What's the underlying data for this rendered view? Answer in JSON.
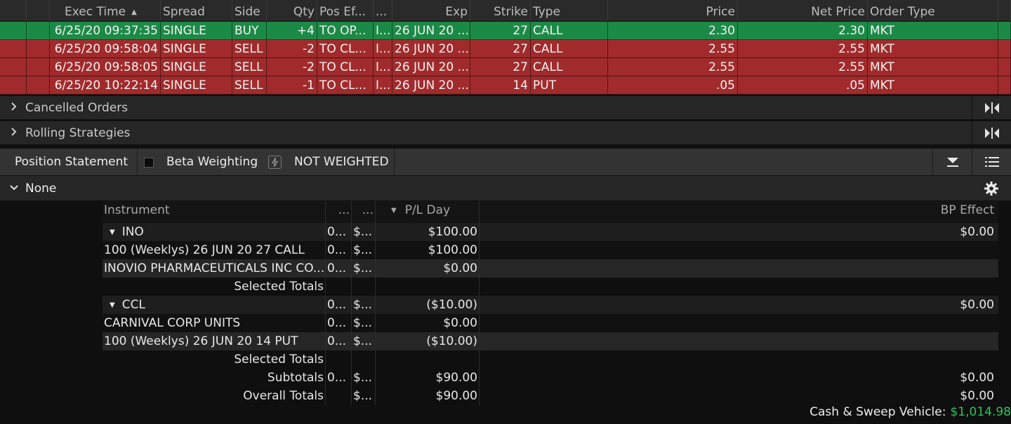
{
  "orders": {
    "columns": {
      "exec_time": "Exec Time",
      "spread": "Spread",
      "side": "Side",
      "qty": "Qty",
      "pos_effect": "Pos Ef...",
      "dots": "...",
      "exp": "Exp",
      "strike": "Strike",
      "type": "Type",
      "price": "Price",
      "net_price": "Net Price",
      "order_type": "Order Type"
    },
    "rows": [
      {
        "exec_time": "6/25/20 09:37:35",
        "spread": "SINGLE",
        "side": "BUY",
        "qty": "+4",
        "pos_effect": "TO OP...",
        "dots": "I...",
        "exp": "26 JUN 20 ...",
        "strike": "27",
        "type": "CALL",
        "price": "2.30",
        "net_price": "2.30",
        "order_type": "MKT"
      },
      {
        "exec_time": "6/25/20 09:58:04",
        "spread": "SINGLE",
        "side": "SELL",
        "qty": "-2",
        "pos_effect": "TO CL...",
        "dots": "I...",
        "exp": "26 JUN 20 ...",
        "strike": "27",
        "type": "CALL",
        "price": "2.55",
        "net_price": "2.55",
        "order_type": "MKT"
      },
      {
        "exec_time": "6/25/20 09:58:05",
        "spread": "SINGLE",
        "side": "SELL",
        "qty": "-2",
        "pos_effect": "TO CL...",
        "dots": "I...",
        "exp": "26 JUN 20 ...",
        "strike": "27",
        "type": "CALL",
        "price": "2.55",
        "net_price": "2.55",
        "order_type": "MKT"
      },
      {
        "exec_time": "6/25/20 10:22:14",
        "spread": "SINGLE",
        "side": "SELL",
        "qty": "-1",
        "pos_effect": "TO CL...",
        "dots": "I...",
        "exp": "26 JUN 20 ...",
        "strike": "14",
        "type": "PUT",
        "price": ".05",
        "net_price": ".05",
        "order_type": "MKT"
      }
    ]
  },
  "sections": {
    "cancelled": "Cancelled Orders",
    "rolling": "Rolling Strategies"
  },
  "position_statement": {
    "title": "Position Statement",
    "beta_label": "Beta Weighting",
    "not_weighted": "NOT WEIGHTED",
    "group_label": "None"
  },
  "positions": {
    "columns": {
      "instrument": "Instrument",
      "d1": "...",
      "d2": "...",
      "pl_day": "P/L Day",
      "bp_effect": "BP Effect"
    },
    "rows": [
      {
        "kind": "grp",
        "instrument": "INO",
        "d1": "0...",
        "d2": "$...",
        "pl_day": "$100.00",
        "bp_effect": "$0.00"
      },
      {
        "kind": "plain",
        "instrument": "100 (Weeklys) 26 JUN 20 27 CALL",
        "d1": "0...",
        "d2": "$...",
        "pl_day": "$100.00",
        "bp_effect": ""
      },
      {
        "kind": "alt",
        "instrument": "INOVIO PHARMACEUTICALS INC CO...",
        "d1": "0...",
        "d2": "$...",
        "pl_day": "$0.00",
        "bp_effect": ""
      },
      {
        "kind": "tot",
        "instrument": "Selected Totals",
        "d1": "",
        "d2": "",
        "pl_day": "",
        "bp_effect": ""
      },
      {
        "kind": "grp",
        "instrument": "CCL",
        "d1": "0...",
        "d2": "$...",
        "pl_day": "($10.00)",
        "bp_effect": "$0.00"
      },
      {
        "kind": "plain",
        "instrument": "CARNIVAL CORP UNITS",
        "d1": "0...",
        "d2": "$...",
        "pl_day": "$0.00",
        "bp_effect": ""
      },
      {
        "kind": "alt",
        "instrument": "100 (Weeklys) 26 JUN 20 14 PUT",
        "d1": "0...",
        "d2": "$...",
        "pl_day": "($10.00)",
        "bp_effect": ""
      },
      {
        "kind": "tot",
        "instrument": "Selected Totals",
        "d1": "",
        "d2": "",
        "pl_day": "",
        "bp_effect": ""
      },
      {
        "kind": "tot",
        "instrument": "Subtotals",
        "d1": "0...",
        "d2": "$...",
        "pl_day": "$90.00",
        "bp_effect": "$0.00"
      },
      {
        "kind": "tot",
        "instrument": "Overall Totals",
        "d1": "",
        "d2": "$...",
        "pl_day": "$90.00",
        "bp_effect": "$0.00"
      }
    ]
  },
  "cash": {
    "label": "Cash & Sweep Vehicle:",
    "value": "$1,014.98"
  },
  "colors": {
    "buy_row": "#1c8a47",
    "sell_row": "#a12b2c",
    "cash_value": "#2ec45a"
  },
  "icons": {
    "expand": "chevron-right-icon",
    "collapse": "chevron-down-icon",
    "column_toggle": "collapse-columns-icon",
    "settings": "gear-icon",
    "menu": "list-icon",
    "dropdown": "triangle-down-icon"
  }
}
